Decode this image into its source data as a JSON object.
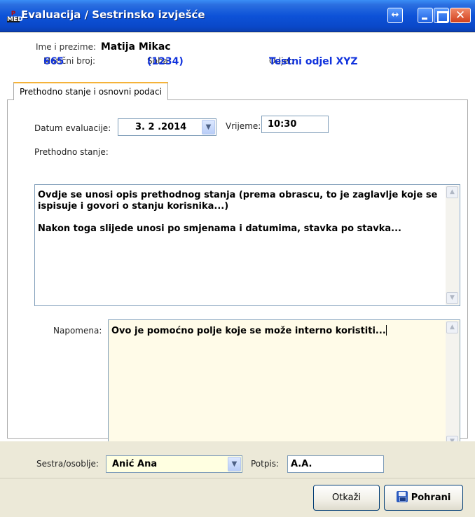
{
  "window": {
    "title": "Evaluacija / Sestrinsko izvješće",
    "app_icon_top": "P",
    "app_icon_bottom": "MED",
    "resize_glyph": "↔",
    "close_glyph": "✕"
  },
  "patient": {
    "name_label": "Ime i prezime:",
    "name": "Matija Mikac",
    "id_label": "Matični broj:",
    "id": "665",
    "room_label": "Soba:",
    "room": "(1234)",
    "ward_label": "Odjel:",
    "ward": "Testni odjel XYZ"
  },
  "tabs": [
    {
      "label": "Prethodno stanje i osnovni podaci",
      "active": true
    }
  ],
  "form": {
    "date_label": "Datum evaluacije:",
    "date_value": "3. 2 .2014",
    "time_label": "Vrijeme:",
    "time_value": "10:30",
    "previous_state_label": "Prethodno stanje:",
    "previous_state_line1": "Ovdje se unosi opis prethodnog stanja (prema obrascu, to je zaglavlje koje se ispisuje i govori o stanju korisnika...)",
    "previous_state_line2": "Nakon toga slijede unosi po smjenama i datumima, stavka po stavka...",
    "note_label": "Napomena:",
    "note_value": "Ovo je pomoćno polje koje se može interno koristiti..."
  },
  "footer": {
    "staff_label": "Sestra/osoblje:",
    "staff_value": "Anić Ana",
    "signature_label": "Potpis:",
    "signature_value": "A.A.",
    "cancel_label": "Otkaži",
    "save_label": "Pohrani"
  },
  "colors": {
    "title_bar": "#0d52d8",
    "value_blue": "#1133dd",
    "note_background": "#fffbe8",
    "staff_background": "#ffffe1",
    "active_tab_accent": "#f5b33a"
  }
}
